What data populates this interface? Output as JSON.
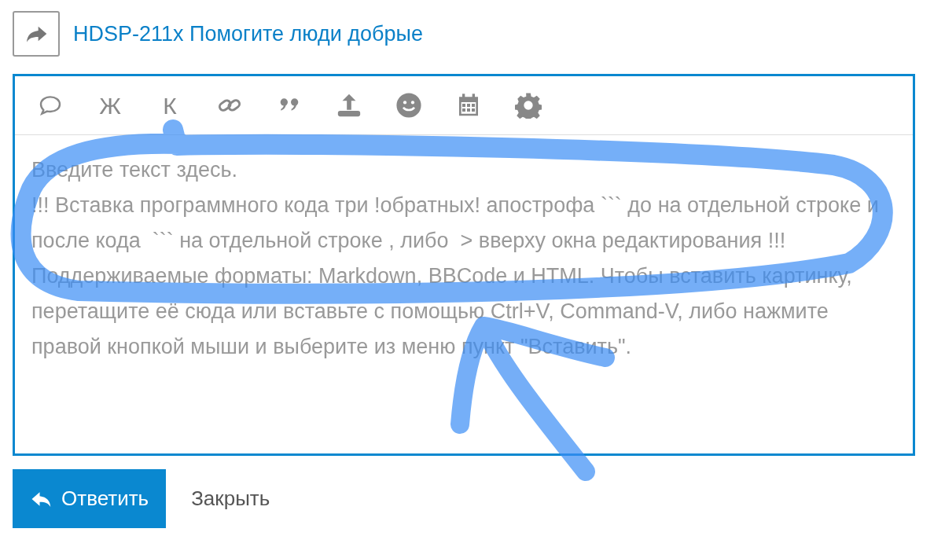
{
  "topic": {
    "title": "HDSP-211x Помогите люди добрые"
  },
  "toolbar": [
    {
      "kind": "icon"
    },
    {
      "kind": "text",
      "label": "Ж"
    },
    {
      "kind": "text",
      "label": "К"
    },
    {
      "kind": "icon"
    },
    {
      "kind": "icon"
    },
    {
      "kind": "icon"
    },
    {
      "kind": "icon"
    },
    {
      "kind": "icon"
    },
    {
      "kind": "icon"
    }
  ],
  "editor": {
    "placeholder": "Введите текст здесь.\n!!! Вставка программного кода три !обратных! апострофа ``` до на отдельной строке и после кода  ``` на отдельной строке , либо  > вверху окна редактирования !!!\nПоддерживаемые форматы: Markdown, BBCode и HTML. Чтобы вставить картинку, перетащите её сюда или вставьте с помощью Ctrl+V, Command-V, либо нажмите правой кнопкой мыши и выберите из меню пункт \"Вставить\"."
  },
  "buttons": [
    {
      "kind": "primary",
      "label": "Ответить"
    },
    {
      "kind": "plain",
      "label": "Закрыть"
    }
  ]
}
